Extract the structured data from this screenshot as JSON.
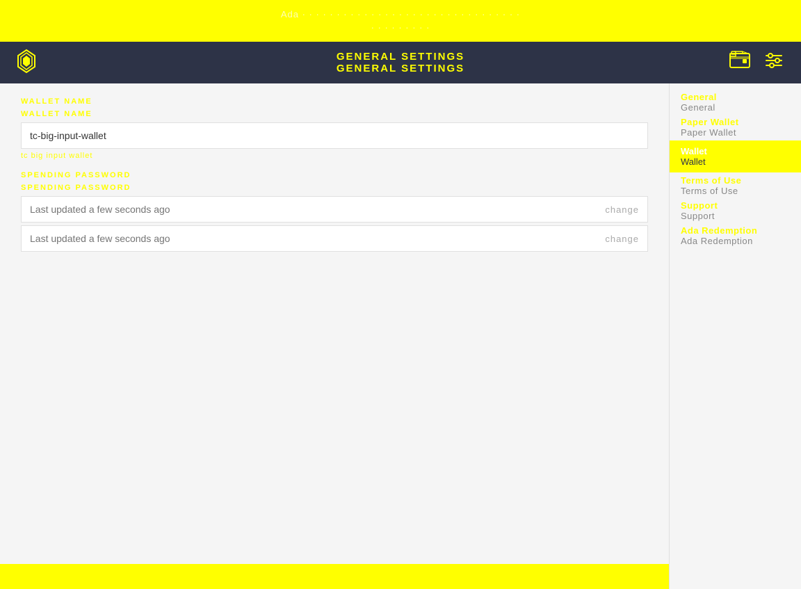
{
  "top_banner": {
    "line1": "Ada · · · · · · · · · · · · · · · · · · · · · · · · · · · · · · · ·",
    "line2": "· · · · · · · · ·"
  },
  "navbar": {
    "title_main": "GENERAL SETTINGS",
    "title_sub": "GENERAL SETTINGS",
    "logo_icon": "⊛",
    "icons": {
      "wallet_icon": "🎒",
      "settings_icon": "⚙"
    }
  },
  "form": {
    "wallet_name_label": "WALLET NAME",
    "wallet_name_label2": "WALLET NAME",
    "wallet_name_value": "tc-big-input-wallet",
    "wallet_name_hint": "tc big input wallet",
    "spending_password_label": "SPENDING PASSWORD",
    "spending_password_label2": "SPENDING PASSWORD",
    "password_placeholder": "Last updated a few seconds ago",
    "password_placeholder2": "Last updated a few seconds ago",
    "change_btn1": "change",
    "change_btn2": "change"
  },
  "sidebar": {
    "items": [
      {
        "id": "general-top",
        "label_top": "General",
        "label_bottom": "General",
        "active": false
      },
      {
        "id": "paper-wallet",
        "label_top": "Paper Wallet",
        "label_bottom": "Paper Wallet",
        "active": false
      },
      {
        "id": "wallet",
        "label_top": "Wallet",
        "label_bottom": "Wallet",
        "active": true
      },
      {
        "id": "terms-of-use",
        "label_top": "Terms of Use",
        "label_bottom": "Terms of Use",
        "active": false
      },
      {
        "id": "support",
        "label_top": "Support",
        "label_bottom": "Support",
        "active": false
      },
      {
        "id": "ada-redemption",
        "label_top": "Ada Redemption",
        "label_bottom": "Ada Redemption",
        "active": false
      }
    ]
  }
}
